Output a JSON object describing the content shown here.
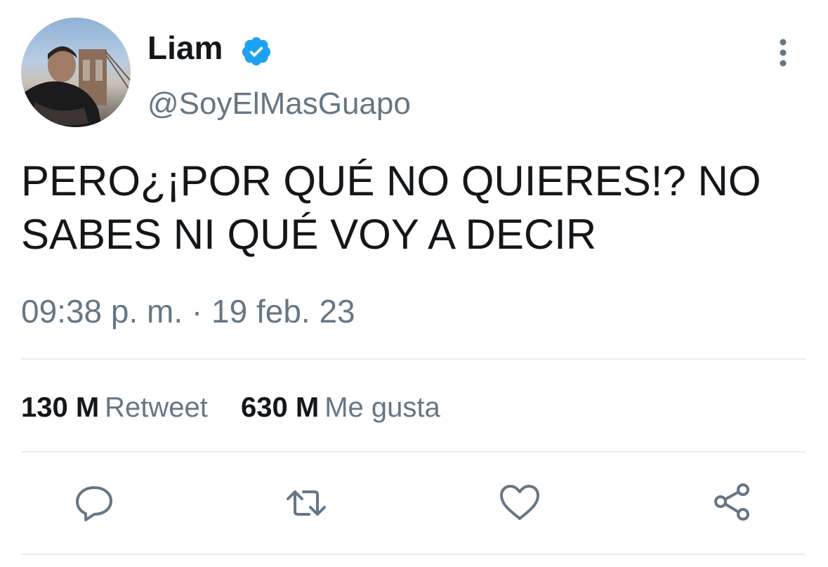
{
  "tweet": {
    "display_name": "Liam",
    "handle": "@SoyElMasGuapo",
    "text": "PERO¿¡POR QUÉ NO QUIERES!? NO SABES NI QUÉ VOY A DECIR",
    "timestamp": "09:38 p. m. · 19 feb. 23",
    "stats": {
      "retweets_count": "130 M",
      "retweets_label": "Retweet",
      "likes_count": "630 M",
      "likes_label": "Me gusta"
    },
    "icons": {
      "verified": "verified-badge-icon",
      "more": "more-vertical-icon",
      "reply": "reply-icon",
      "retweet": "retweet-icon",
      "like": "heart-icon",
      "share": "share-icon"
    },
    "colors": {
      "verified_blue": "#1da1f2",
      "secondary_text": "#657786",
      "primary_text": "#14171a"
    }
  }
}
